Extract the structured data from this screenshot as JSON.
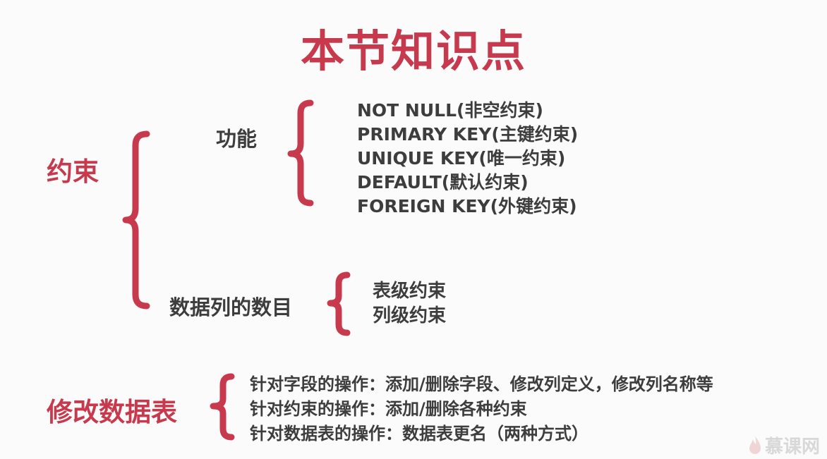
{
  "title": "本节知识点",
  "constraints": {
    "label": "约束",
    "function": {
      "label": "功能",
      "items": [
        "NOT NULL(非空约束)",
        "PRIMARY KEY(主键约束)",
        "UNIQUE KEY(唯一约束)",
        "DEFAULT(默认约束)",
        "FOREIGN KEY(外键约束)"
      ]
    },
    "column_count": {
      "label": "数据列的数目",
      "items": [
        "表级约束",
        "列级约束"
      ]
    }
  },
  "modify_table": {
    "label": "修改数据表",
    "items": [
      "针对字段的操作：添加/删除字段、修改列定义，修改列名称等",
      "针对约束的操作：添加/删除各种约束",
      "针对数据表的操作：数据表更名（两种方式）"
    ]
  },
  "watermark": {
    "text": "慕课网",
    "icon": "flame-logo-icon"
  },
  "colors": {
    "accent": "#c73a4d",
    "text": "#3d3d3d",
    "background": "#fbfbfb",
    "watermark": "#d8d8d8"
  }
}
